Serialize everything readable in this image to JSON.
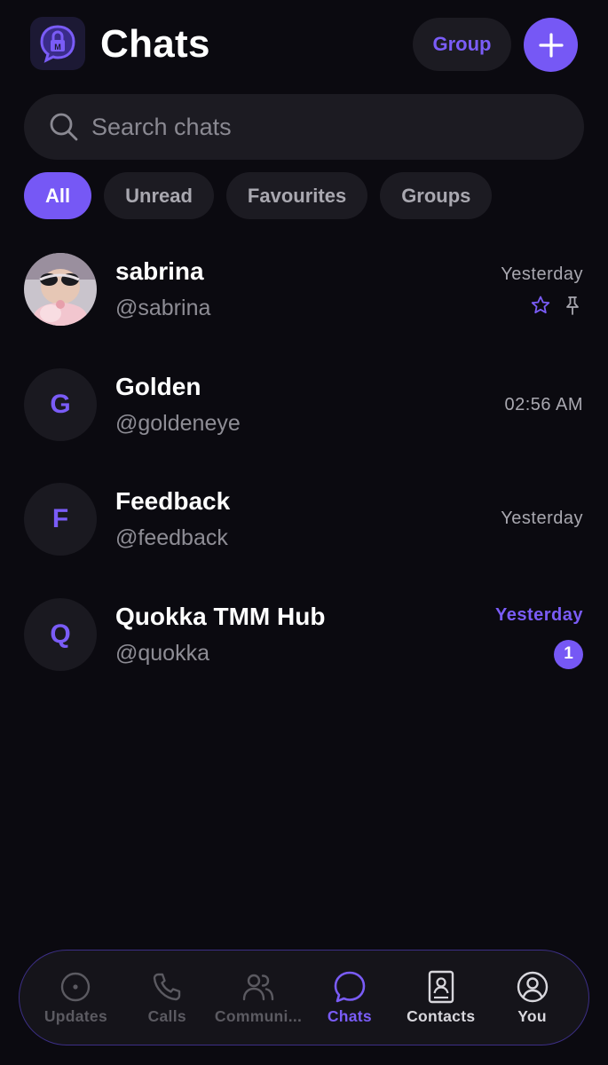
{
  "header": {
    "title": "Chats",
    "group_label": "Group"
  },
  "search": {
    "placeholder": "Search chats"
  },
  "filters": [
    {
      "label": "All",
      "active": true
    },
    {
      "label": "Unread",
      "active": false
    },
    {
      "label": "Favourites",
      "active": false
    },
    {
      "label": "Groups",
      "active": false
    }
  ],
  "chats": [
    {
      "name": "sabrina",
      "handle": "@sabrina",
      "time": "Yesterday",
      "avatar": "photo",
      "starred": true,
      "pinned": true
    },
    {
      "name": "Golden",
      "handle": "@goldeneye",
      "time": "02:56 AM",
      "avatar_letter": "G"
    },
    {
      "name": "Feedback",
      "handle": "@feedback",
      "time": "Yesterday",
      "avatar_letter": "F"
    },
    {
      "name": "Quokka TMM Hub",
      "handle": "@quokka",
      "time": "Yesterday",
      "avatar_letter": "Q",
      "unread_count": "1"
    }
  ],
  "tabbar": [
    {
      "label": "Updates",
      "icon": "status-icon"
    },
    {
      "label": "Calls",
      "icon": "phone-icon"
    },
    {
      "label": "Communi...",
      "icon": "people-icon"
    },
    {
      "label": "Chats",
      "icon": "chat-bubble-icon",
      "active": true
    },
    {
      "label": "Contacts",
      "icon": "contacts-book-icon"
    },
    {
      "label": "You",
      "icon": "profile-icon"
    }
  ],
  "colors": {
    "accent": "#7658f5",
    "background": "#0b0a10",
    "surface": "#1c1b22"
  }
}
